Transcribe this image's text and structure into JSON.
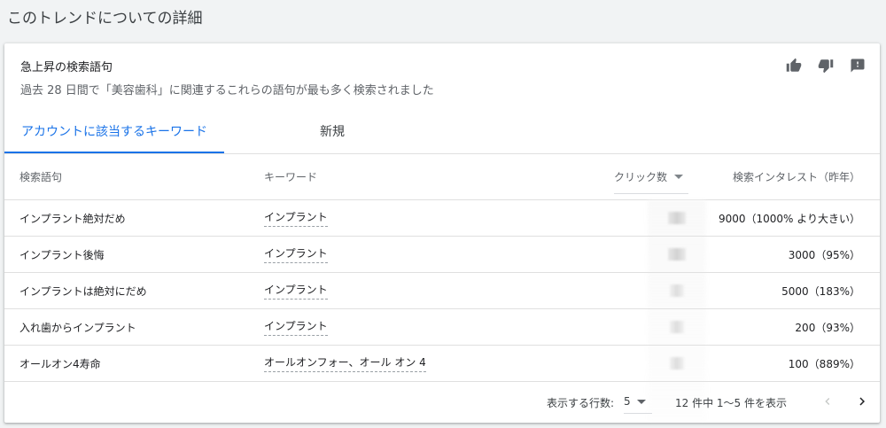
{
  "page": {
    "heading": "このトレンドについての詳細"
  },
  "card": {
    "title": "急上昇の検索語句",
    "subtitle": "過去 28 日間で「美容歯科」に関連するこれらの語句が最も多く検索されました",
    "feedback_icons": [
      "thumb-up-icon",
      "thumb-down-icon",
      "feedback-icon"
    ]
  },
  "tabs": [
    {
      "label": "アカウントに該当するキーワード",
      "active": true
    },
    {
      "label": "新規",
      "active": false
    }
  ],
  "table": {
    "headers": {
      "term": "検索語句",
      "keyword": "キーワード",
      "clicks": "クリック数",
      "interest": "検索インタレスト（昨年）"
    },
    "rows": [
      {
        "term": "インプラント絶対だめ",
        "keyword": "インプラント",
        "interest": "9000（1000% より大きい）"
      },
      {
        "term": "インプラント後悔",
        "keyword": "インプラント",
        "interest": "3000（95%）"
      },
      {
        "term": "インプラントは絶対にだめ",
        "keyword": "インプラント",
        "interest": "5000（183%）"
      },
      {
        "term": "入れ歯からインプラント",
        "keyword": "インプラント",
        "interest": "200（93%）"
      },
      {
        "term": "オールオン4寿命",
        "keyword": "オールオンフォー、オール オン 4",
        "interest": "100（889%）"
      }
    ]
  },
  "pagination": {
    "rows_label": "表示する行数:",
    "rows_value": "5",
    "range_text": "12 件中 1～5 件を表示"
  },
  "colors": {
    "accent": "#1a73e8",
    "icon": "#5f6368"
  }
}
